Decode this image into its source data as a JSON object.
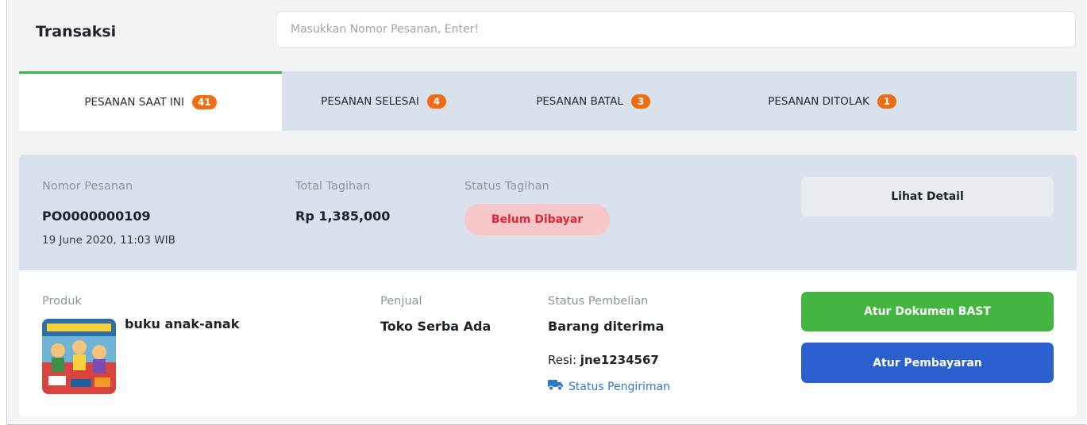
{
  "header": {
    "title": "Transaksi",
    "search_placeholder": "Masukkan Nomor Pesanan, Enter!"
  },
  "tabs": [
    {
      "label": "PESANAN SAAT INI",
      "count": "41",
      "active": true
    },
    {
      "label": "PESANAN SELESAI",
      "count": "4",
      "active": false
    },
    {
      "label": "PESANAN BATAL",
      "count": "3",
      "active": false
    },
    {
      "label": "PESANAN DITOLAK",
      "count": "1",
      "active": false
    }
  ],
  "order": {
    "number_label": "Nomor Pesanan",
    "number": "PO0000000109",
    "date": "19 June 2020, 11:03 WIB",
    "total_label": "Total Tagihan",
    "total": "Rp 1,385,000",
    "bill_status_label": "Status Tagihan",
    "bill_status": "Belum Dibayar",
    "detail_button": "Lihat Detail",
    "product_label": "Produk",
    "product_name": "buku anak-anak",
    "seller_label": "Penjual",
    "seller": "Toko Serba Ada",
    "purchase_status_label": "Status Pembelian",
    "purchase_status": "Barang diterima",
    "resi_label": "Resi:",
    "resi_value": "jne1234567",
    "shipping_link": "Status Pengiriman",
    "bast_button": "Atur Dokumen BAST",
    "payment_button": "Atur Pembayaran"
  },
  "colors": {
    "accent_green": "#43b540",
    "accent_blue": "#2c5fce",
    "badge_orange": "#f06c10",
    "status_red": "#e0253a",
    "link_blue": "#2f78c9"
  },
  "icons": {
    "shipping": "truck-icon"
  }
}
